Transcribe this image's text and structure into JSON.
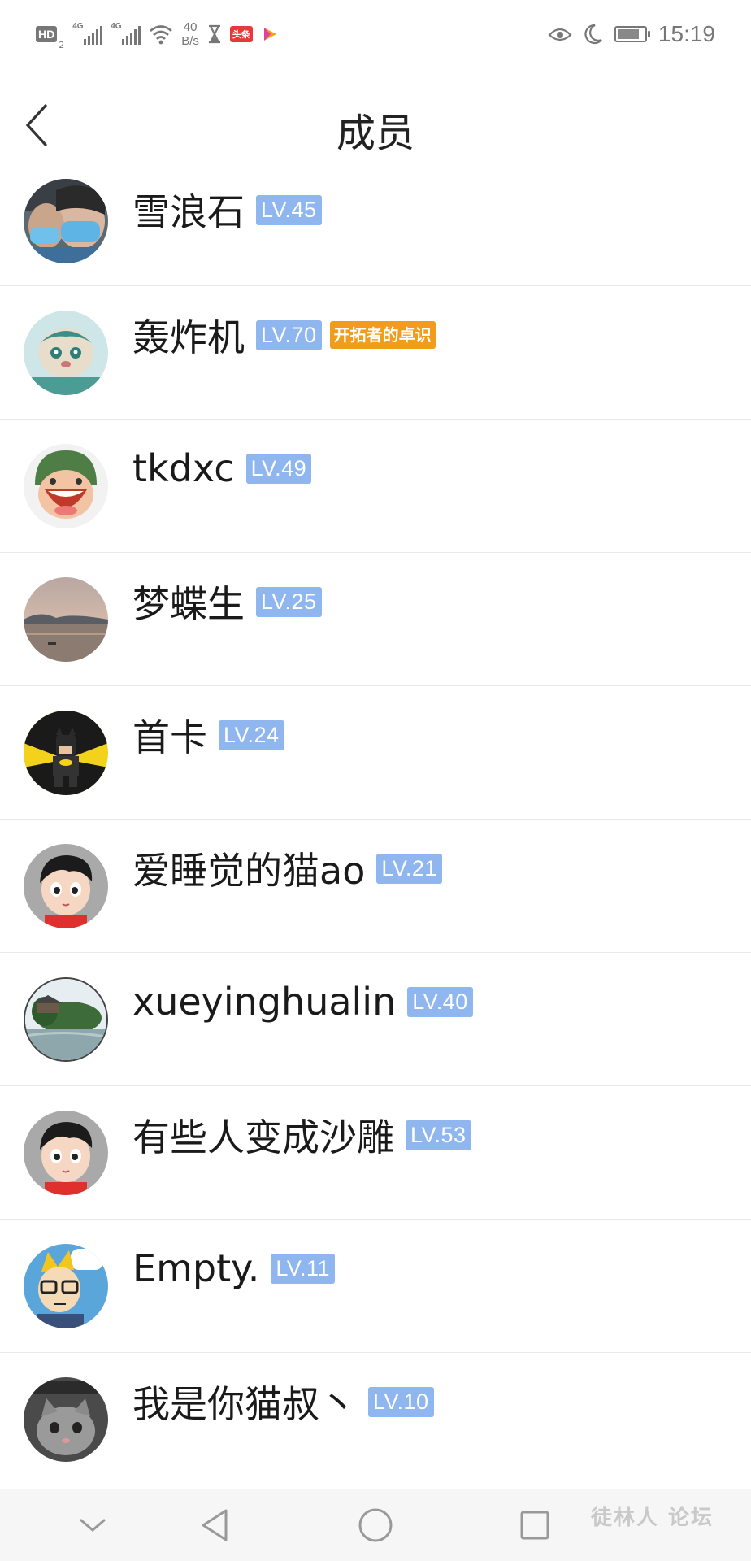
{
  "status_bar": {
    "hd_label": "HD",
    "hd_sub": "2",
    "net1": "4G",
    "net2": "4G",
    "speed_value": "40",
    "speed_unit": "B/s",
    "toutiao_label": "头条",
    "time": "15:19",
    "battery_level": 0.8
  },
  "header": {
    "title": "成员"
  },
  "members": [
    {
      "name": "雪浪石",
      "level": "LV.45",
      "avatar": "masks-photo-avatar"
    },
    {
      "name": "轰炸机",
      "level": "LV.70",
      "badge": "开拓者的卓识",
      "avatar": "cartoon-creature-avatar"
    },
    {
      "name": "tkdxc",
      "level": "LV.49",
      "avatar": "cartoon-soldier-avatar"
    },
    {
      "name": "梦蝶生",
      "level": "LV.25",
      "avatar": "lake-sunset-avatar"
    },
    {
      "name": "首卡",
      "level": "LV.24",
      "avatar": "lego-batman-avatar"
    },
    {
      "name": "爱睡觉的猫ao",
      "level": "LV.21",
      "avatar": "cartoon-boy-avatar"
    },
    {
      "name": "xueyinghualin",
      "level": "LV.40",
      "avatar": "garden-photo-avatar"
    },
    {
      "name": "有些人变成沙雕",
      "level": "LV.53",
      "avatar": "cartoon-boy-avatar"
    },
    {
      "name": "Empty.",
      "level": "LV.11",
      "avatar": "cartoon-glasses-avatar"
    },
    {
      "name": "我是你猫叔丶",
      "level": "LV.10",
      "avatar": "cat-meme-avatar"
    }
  ],
  "nav_bar": {
    "items": [
      "chevron-down-icon",
      "back-triangle-icon",
      "home-circle-icon",
      "recents-square-icon"
    ]
  },
  "watermark": {
    "text": "徒林人 论坛"
  },
  "colors": {
    "level_badge": "#8fb6ee",
    "medal_badge": "#ef9d1a",
    "divider": "#e8e8e8"
  }
}
